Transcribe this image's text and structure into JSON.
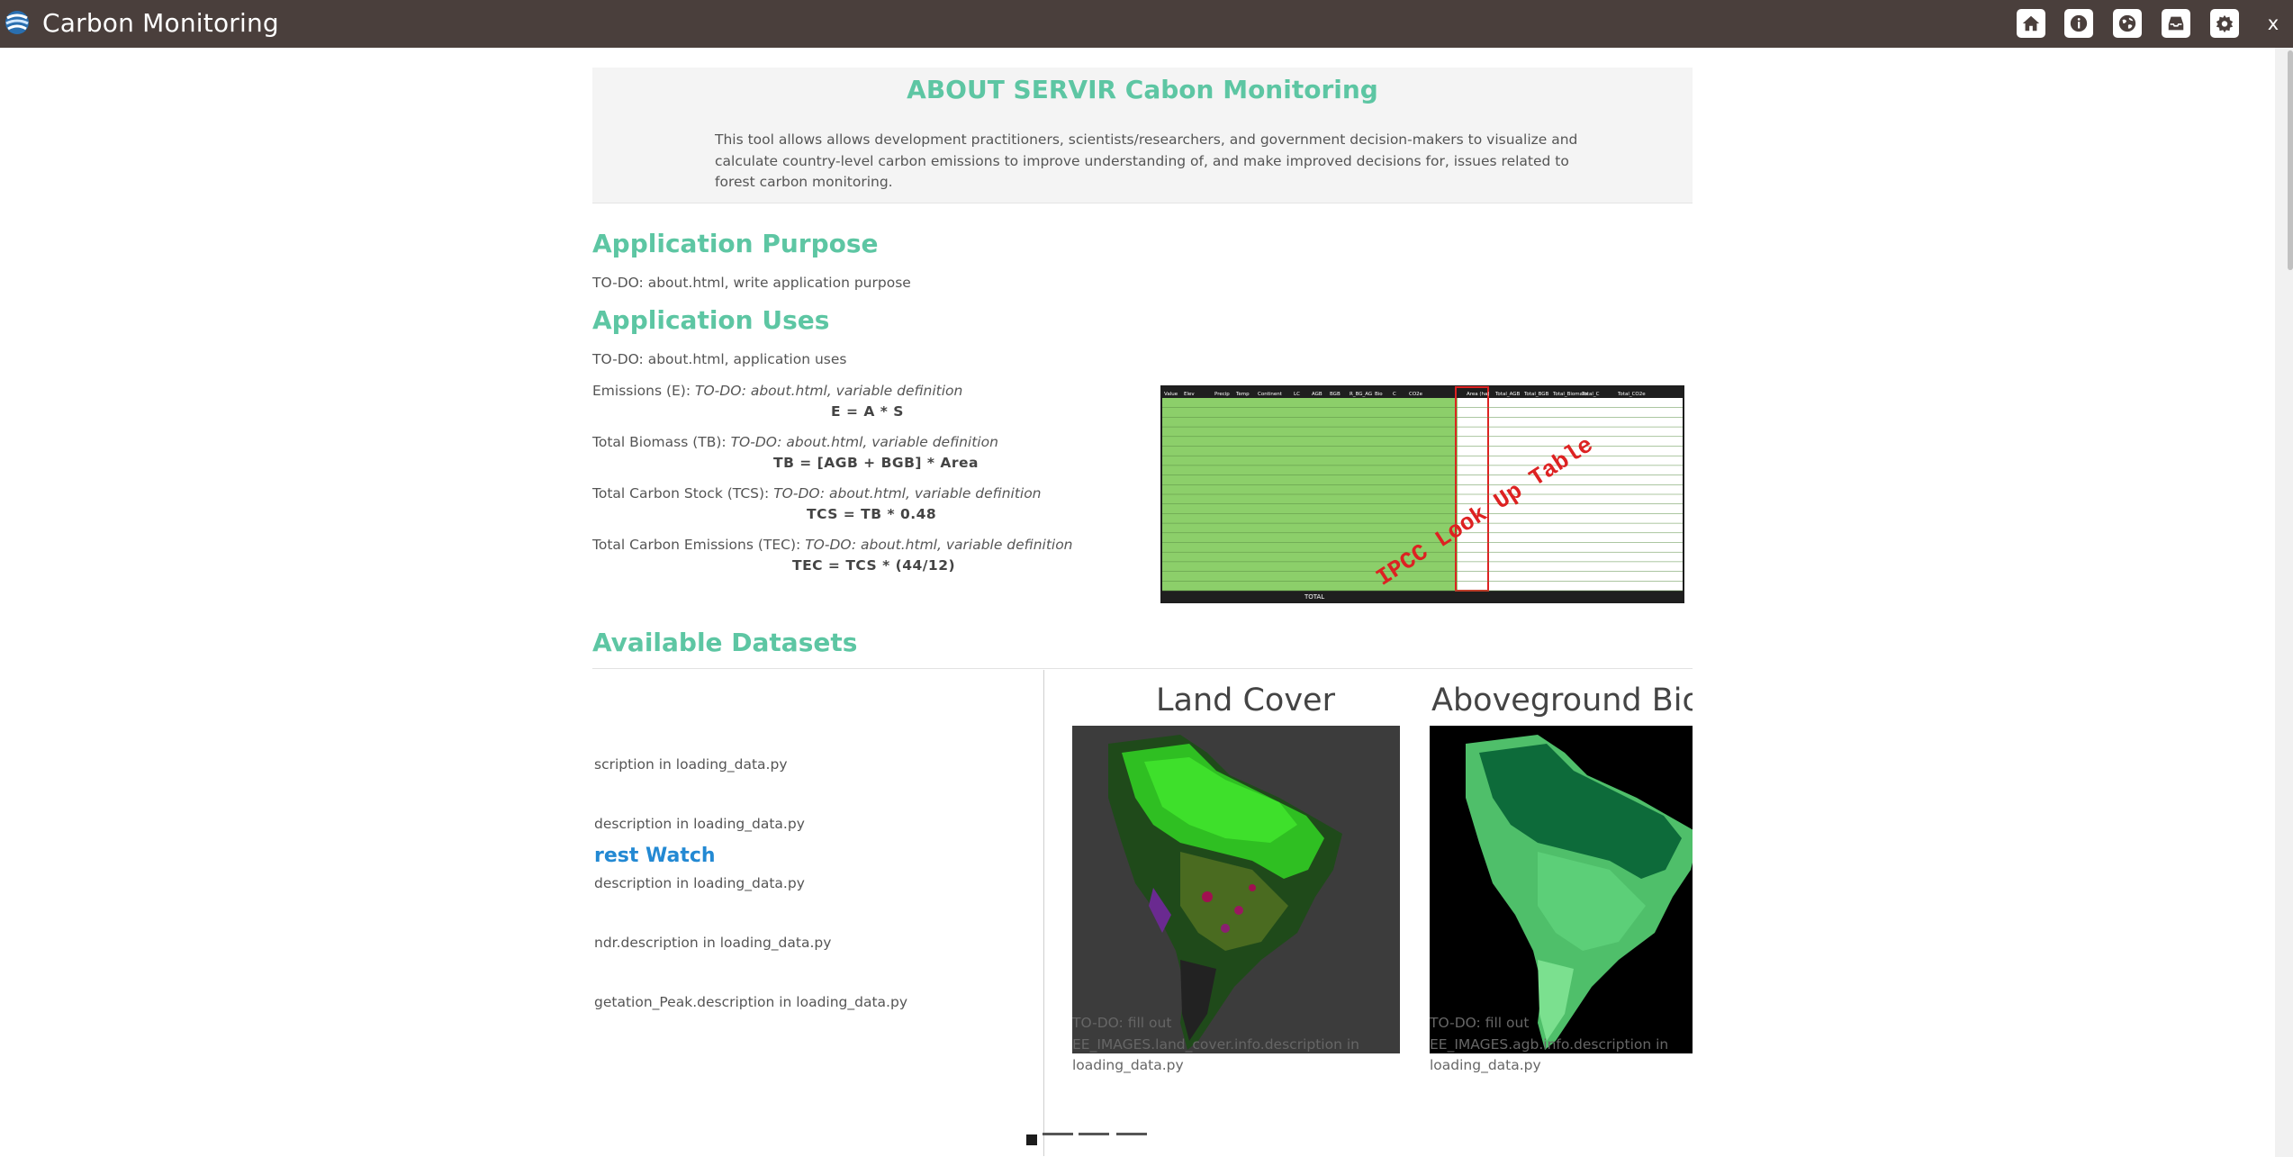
{
  "header": {
    "title": "Carbon Monitoring",
    "buttons": [
      "home-icon",
      "info-icon",
      "globe-icon",
      "inbox-icon",
      "gear-icon"
    ],
    "close_label": "x",
    "bar_color": "#4a3f3c"
  },
  "about": {
    "title": "ABOUT SERVIR Cabon Monitoring",
    "text": "This tool allows allows development practitioners, scientists/researchers, and government decision-makers to visualize and calculate country-level carbon emissions to improve understanding of, and make improved decisions for, issues related to forest carbon monitoring."
  },
  "purpose": {
    "heading": "Application Purpose",
    "text": "TO-DO: about.html, write application purpose"
  },
  "uses": {
    "heading": "Application Uses",
    "text": "TO-DO: about.html, application uses",
    "definitions": [
      {
        "label": "Emissions (E):",
        "todo": "TO-DO: about.html, variable definition",
        "formula": "E = A * S"
      },
      {
        "label": "Total Biomass (TB):",
        "todo": "TO-DO: about.html, variable definition",
        "formula": "TB = [AGB + BGB] * Area"
      },
      {
        "label": "Total Carbon Stock (TCS):",
        "todo": "TO-DO: about.html, variable definition",
        "formula": "TCS = TB * 0.48"
      },
      {
        "label": "Total Carbon Emissions (TEC):",
        "todo": "TO-DO: about.html, variable definition",
        "formula": "TEC = TCS * (44/12)"
      }
    ],
    "lookup_table_stamp": "IPCC Look Up Table",
    "lookup_headers": [
      "Value",
      "Elev",
      "Precip",
      "Temp",
      "Continent",
      "LC",
      "AGB",
      "BGB",
      "R_BG_AG",
      "Bio",
      "C",
      "CO2e",
      "Area (ha)",
      "Total_AGB",
      "Total_BGB",
      "Total_Biomass",
      "Total_C",
      "Total_CO2e"
    ],
    "lookup_total": "TOTAL"
  },
  "datasets": {
    "heading": "Available Datasets",
    "list": [
      "scription in loading_data.py",
      "description in loading_data.py",
      "description in loading_data.py",
      "ndr.description in loading_data.py",
      "getation_Peak.description in loading_data.py"
    ],
    "link": "rest Watch",
    "cards": [
      {
        "title": "Land Cover",
        "desc": "TO-DO: fill out EE_IMAGES.land_cover.info.description in loading_data.py"
      },
      {
        "title": "Aboveground Biomass",
        "desc": "TO-DO: fill out EE_IMAGES.agb.info.description in loading_data.py"
      }
    ]
  },
  "colors": {
    "accent": "#5dc6a3",
    "link": "#2389d3"
  }
}
